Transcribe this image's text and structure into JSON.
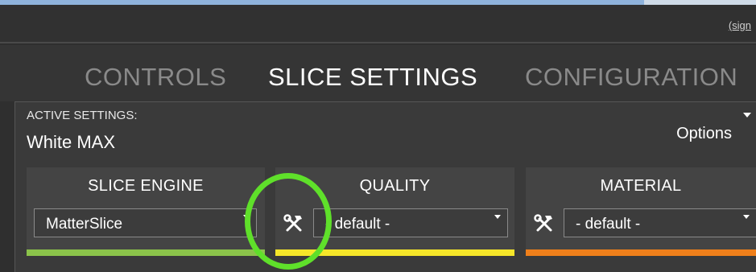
{
  "account": {
    "sign_link": "(sign"
  },
  "tabs": [
    {
      "label": "CONTROLS",
      "active": false
    },
    {
      "label": "SLICE SETTINGS",
      "active": true
    },
    {
      "label": "CONFIGURATION",
      "active": false
    }
  ],
  "settings": {
    "active_label": "ACTIVE SETTINGS:",
    "active_value": "White MAX",
    "options_label": "Options"
  },
  "cards": [
    {
      "title": "SLICE ENGINE",
      "value": "MatterSlice",
      "has_tool_icon": false,
      "bar_color": "#8bc34a"
    },
    {
      "title": "QUALITY",
      "value": "- default -",
      "has_tool_icon": true,
      "icon": "hammer-wrench-icon",
      "bar_color": "#f5e629"
    },
    {
      "title": "MATERIAL",
      "value": "- default -",
      "has_tool_icon": true,
      "icon": "hammer-wrench-icon",
      "bar_color": "#ef7f1a"
    }
  ],
  "colors": {
    "background": "#2f2f2f",
    "panel": "#3a3a3a",
    "card": "#444444",
    "active_tab": "#ffffff",
    "inactive_tab": "#8a8a8a",
    "highlight": "#5fe02a"
  }
}
